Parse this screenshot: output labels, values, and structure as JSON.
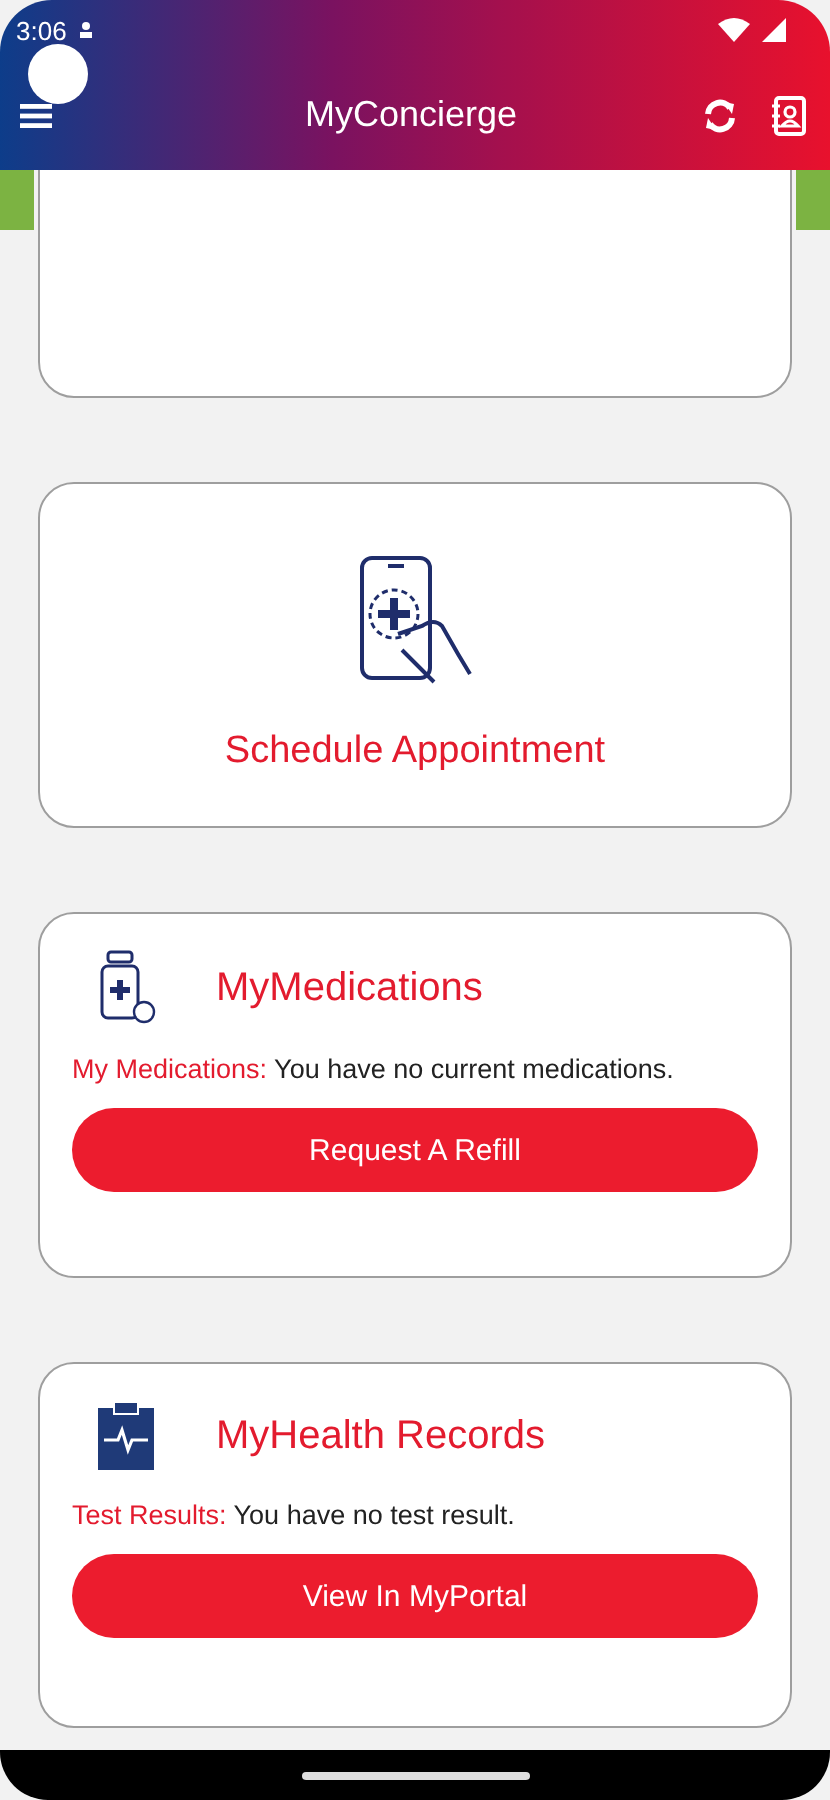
{
  "status_bar": {
    "time": "3:06"
  },
  "app_bar": {
    "title": "MyConcierge"
  },
  "cards": [
    {
      "kind": "blank"
    },
    {
      "kind": "action",
      "title": "Schedule Appointment"
    },
    {
      "kind": "info",
      "title": "MyMedications",
      "label": "My Medications:",
      "text": "You have no current medications.",
      "button": "Request A Refill"
    },
    {
      "kind": "info",
      "title": "MyHealth Records",
      "label": "Test Results:",
      "text": "You have no test result.",
      "button": "View In MyPortal"
    }
  ]
}
